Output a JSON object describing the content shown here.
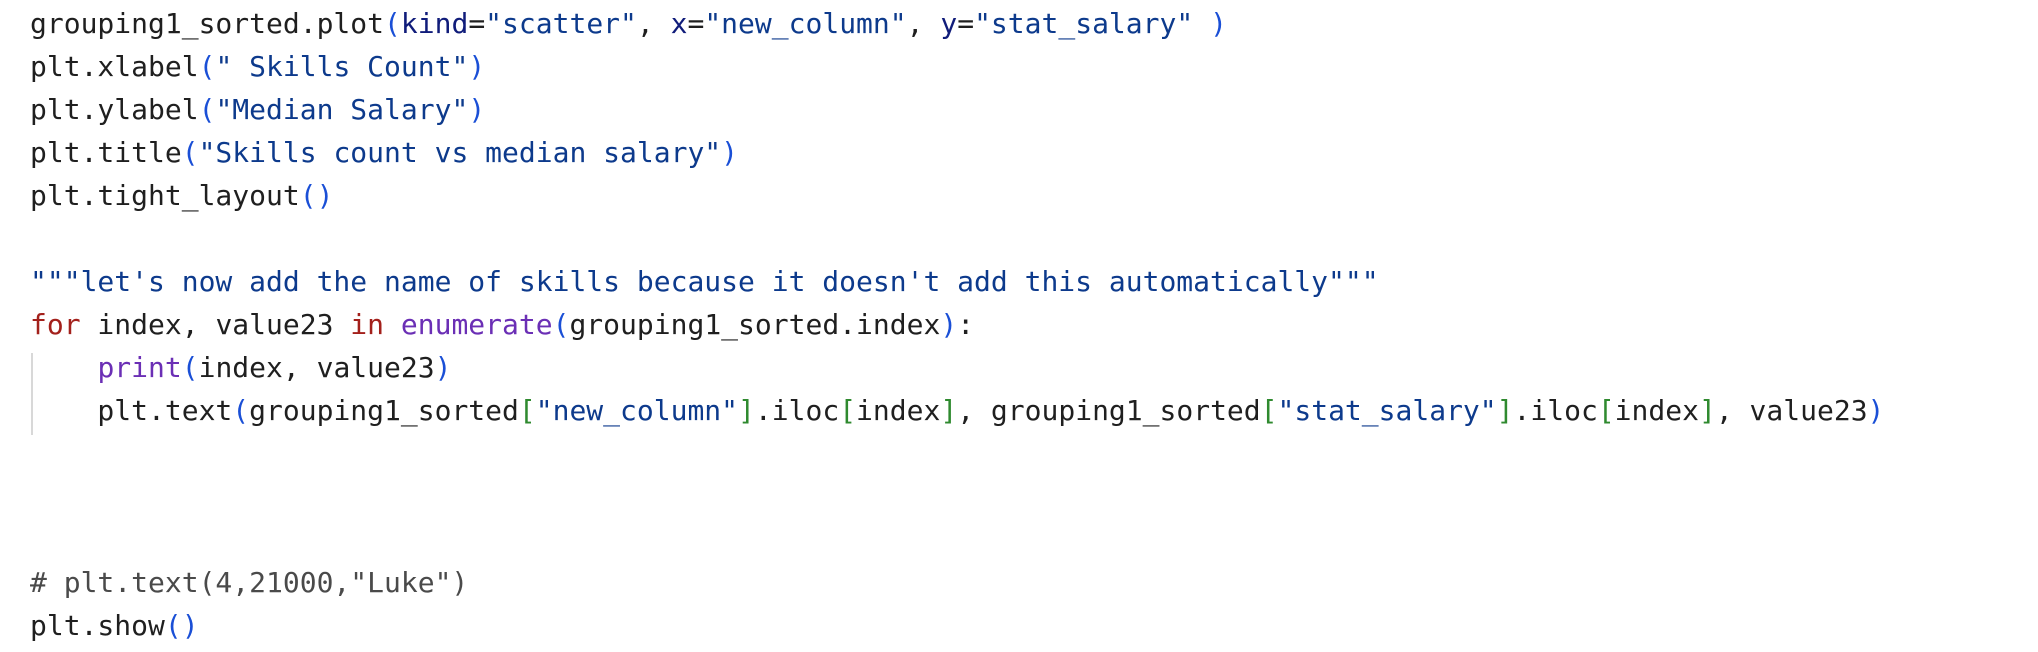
{
  "editor": {
    "lines": [
      {
        "tokens": [
          {
            "text": "grouping1_sorted.plot",
            "type": "default"
          },
          {
            "text": "(",
            "type": "paren"
          },
          {
            "text": "kind",
            "type": "param"
          },
          {
            "text": "=",
            "type": "op"
          },
          {
            "text": "\"scatter\"",
            "type": "string"
          },
          {
            "text": ", ",
            "type": "default"
          },
          {
            "text": "x",
            "type": "param"
          },
          {
            "text": "=",
            "type": "op"
          },
          {
            "text": "\"new_column\"",
            "type": "string"
          },
          {
            "text": ", ",
            "type": "default"
          },
          {
            "text": "y",
            "type": "param"
          },
          {
            "text": "=",
            "type": "op"
          },
          {
            "text": "\"stat_salary\"",
            "type": "string"
          },
          {
            "text": " )",
            "type": "paren"
          }
        ]
      },
      {
        "tokens": [
          {
            "text": "plt.xlabel",
            "type": "default"
          },
          {
            "text": "(",
            "type": "paren"
          },
          {
            "text": "\" Skills Count\"",
            "type": "string"
          },
          {
            "text": ")",
            "type": "paren"
          }
        ]
      },
      {
        "tokens": [
          {
            "text": "plt.ylabel",
            "type": "default"
          },
          {
            "text": "(",
            "type": "paren"
          },
          {
            "text": "\"Median Salary\"",
            "type": "string"
          },
          {
            "text": ")",
            "type": "paren"
          }
        ]
      },
      {
        "tokens": [
          {
            "text": "plt.title",
            "type": "default"
          },
          {
            "text": "(",
            "type": "paren"
          },
          {
            "text": "\"Skills count vs median salary\"",
            "type": "string"
          },
          {
            "text": ")",
            "type": "paren"
          }
        ]
      },
      {
        "tokens": [
          {
            "text": "plt.tight_layout",
            "type": "default"
          },
          {
            "text": "()",
            "type": "paren"
          }
        ]
      },
      {
        "tokens": []
      },
      {
        "tokens": [
          {
            "text": "\"\"\"let's now add the name of skills because it doesn't add this automatically\"\"\"",
            "type": "string"
          }
        ]
      },
      {
        "tokens": [
          {
            "text": "for",
            "type": "keyword"
          },
          {
            "text": " index, value23 ",
            "type": "default"
          },
          {
            "text": "in",
            "type": "keyword"
          },
          {
            "text": " ",
            "type": "default"
          },
          {
            "text": "enumerate",
            "type": "builtin"
          },
          {
            "text": "(",
            "type": "paren"
          },
          {
            "text": "grouping1_sorted.index",
            "type": "default"
          },
          {
            "text": ")",
            "type": "paren"
          },
          {
            "text": ":",
            "type": "default"
          }
        ]
      },
      {
        "tokens": [
          {
            "text": "    ",
            "type": "default"
          },
          {
            "text": "print",
            "type": "builtin"
          },
          {
            "text": "(",
            "type": "paren"
          },
          {
            "text": "index, value23",
            "type": "default"
          },
          {
            "text": ")",
            "type": "paren"
          }
        ]
      },
      {
        "tokens": [
          {
            "text": "    plt.text",
            "type": "default"
          },
          {
            "text": "(",
            "type": "paren"
          },
          {
            "text": "grouping1_sorted",
            "type": "default"
          },
          {
            "text": "[",
            "type": "bracket"
          },
          {
            "text": "\"new_column\"",
            "type": "string"
          },
          {
            "text": "]",
            "type": "bracket"
          },
          {
            "text": ".iloc",
            "type": "default"
          },
          {
            "text": "[",
            "type": "bracket"
          },
          {
            "text": "index",
            "type": "default"
          },
          {
            "text": "]",
            "type": "bracket"
          },
          {
            "text": ", grouping1_sorted",
            "type": "default"
          },
          {
            "text": "[",
            "type": "bracket"
          },
          {
            "text": "\"stat_salary\"",
            "type": "string"
          },
          {
            "text": "]",
            "type": "bracket"
          },
          {
            "text": ".iloc",
            "type": "default"
          },
          {
            "text": "[",
            "type": "bracket"
          },
          {
            "text": "index",
            "type": "default"
          },
          {
            "text": "]",
            "type": "bracket"
          },
          {
            "text": ", value23",
            "type": "default"
          },
          {
            "text": ")",
            "type": "paren"
          }
        ]
      },
      {
        "tokens": []
      },
      {
        "tokens": []
      },
      {
        "tokens": []
      },
      {
        "tokens": [
          {
            "text": "# plt.text(4,21000,\"Luke\")",
            "type": "comment"
          }
        ]
      },
      {
        "tokens": [
          {
            "text": "plt.show",
            "type": "default"
          },
          {
            "text": "()",
            "type": "paren"
          }
        ]
      }
    ]
  },
  "colors": {
    "default": "#1f1f1f",
    "string": "#0d3a8c",
    "param": "#101c7a",
    "paren": "#1a4fd6",
    "bracket": "#2f8a2f",
    "keyword": "#a3201b",
    "builtin": "#6b2fb5",
    "comment": "#4a4a4a"
  }
}
